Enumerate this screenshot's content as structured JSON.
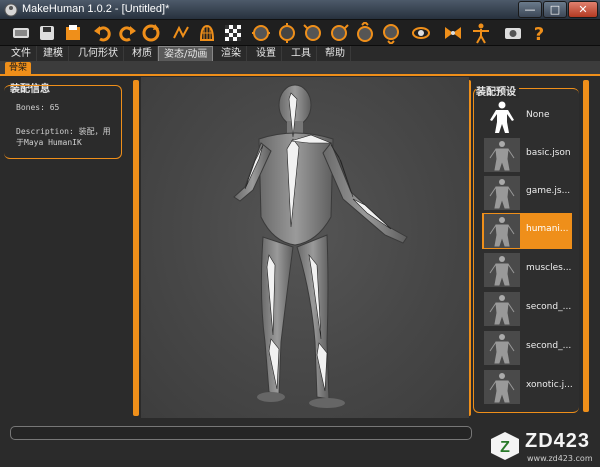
{
  "window": {
    "title": "MakeHuman 1.0.2 - [Untitled]*",
    "min": "—",
    "max": "□",
    "close": "✕"
  },
  "toolbar": {
    "buttons": [
      "new-icon",
      "save-icon",
      "load-icon",
      "undo-icon",
      "redo-icon",
      "reset-icon",
      "wireframe-icon",
      "smooth-icon",
      "background-icon",
      "front-view-icon",
      "back-view-icon",
      "left-view-icon",
      "right-view-icon",
      "top-view-icon",
      "bottom-view-icon",
      "global-camera-icon",
      "pose-icon",
      "screenshot-icon",
      "help-icon"
    ]
  },
  "menu": {
    "tabs": [
      "文件",
      "建模",
      "几何形状",
      "材质",
      "姿态/动画",
      "渲染",
      "设置",
      "工具",
      "帮助"
    ],
    "active": "姿态/动画",
    "subtab": "骨架"
  },
  "rig_info": {
    "title": "装配信息",
    "bones": "Bones: 65",
    "description": "Description: 装配，用于Maya HumanIK"
  },
  "presets": {
    "title": "装配预设",
    "items": [
      {
        "label": "None"
      },
      {
        "label": "basic.json"
      },
      {
        "label": "game.js..."
      },
      {
        "label": "humani..."
      },
      {
        "label": "muscles..."
      },
      {
        "label": "second_..."
      },
      {
        "label": "second_..."
      },
      {
        "label": "xonotic.j..."
      }
    ],
    "selected_index": 3
  },
  "watermark": {
    "logo": "ZD423",
    "url": "www.zd423.com"
  },
  "colors": {
    "accent": "#ef8f1a",
    "background": "#2b2b2b",
    "viewport": "#4a4a4a"
  }
}
